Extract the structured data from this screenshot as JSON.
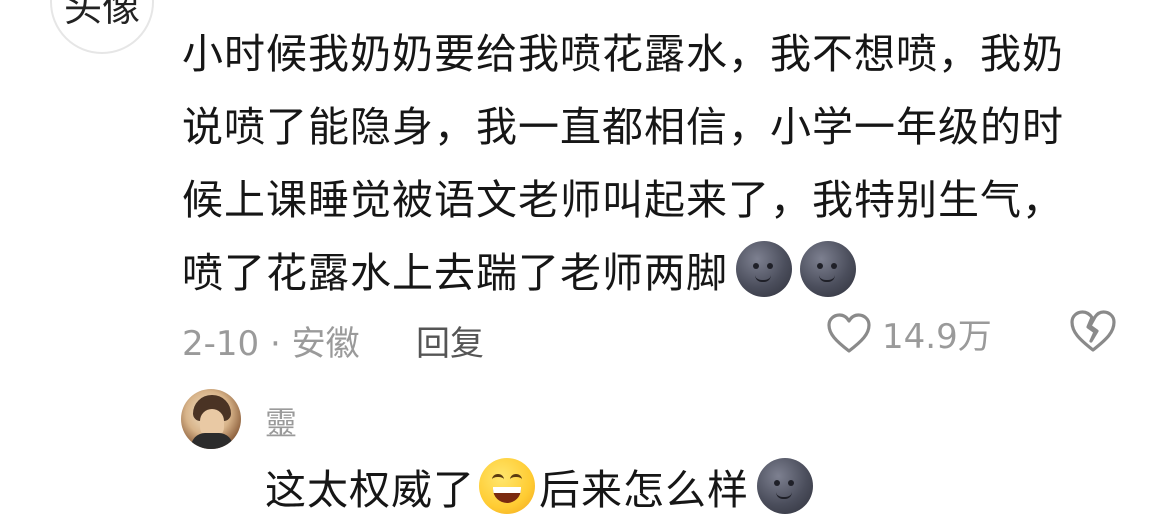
{
  "top_comment": {
    "avatar_text": "头像",
    "lines": [
      "小时候我奶奶要给我喷花露水，我不想喷，我奶",
      "说喷了能隐身，我一直都相信，小学一年级的时",
      "候上课睡觉被语文老师叫起来了，我特别生气，",
      "喷了花露水上去踹了老师两脚"
    ],
    "trailing_emojis": [
      "moon-face-emoji",
      "moon-face-emoji"
    ],
    "date_location": "2-10 · 安徽",
    "reply_label": "回复",
    "like_count": "14.9万",
    "icons": {
      "like": "heart-outline-icon",
      "dislike": "broken-heart-icon"
    }
  },
  "reply": {
    "username": "靈",
    "text_before_emoji": "这太权威了",
    "inline_emoji": "grinning-squinting-emoji",
    "text_after_emoji": "后来怎么样",
    "trailing_emoji": "moon-face-emoji"
  },
  "colors": {
    "text": "#161616",
    "meta": "#9a9a9a",
    "reply_btn": "#555555"
  }
}
